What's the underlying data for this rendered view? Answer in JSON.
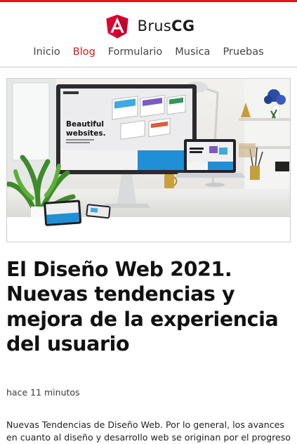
{
  "brand": {
    "prefix": "Brus",
    "suffix": "CG",
    "logo_letter": "A"
  },
  "nav": {
    "items": [
      {
        "label": "Inicio",
        "active": false
      },
      {
        "label": "Blog",
        "active": true
      },
      {
        "label": "Formulario",
        "active": false
      },
      {
        "label": "Musica",
        "active": false
      },
      {
        "label": "Pruebas",
        "active": false
      }
    ]
  },
  "post": {
    "image_text": {
      "headline_line1": "Beautiful",
      "headline_line2": "websites."
    },
    "title": "El Diseño Web 2021. Nuevas tendencias y mejora de la experiencia del usuario",
    "time_ago": "hace 11 minutos",
    "excerpt": "Nuevas Tendencias de Diseño Web. Por lo general, los avances en cuanto al diseño y desarrollo web se originan por el progreso"
  },
  "colors": {
    "accent": "#d51a1a",
    "top_bar": "#e4121a",
    "logo": "#dd0031"
  }
}
